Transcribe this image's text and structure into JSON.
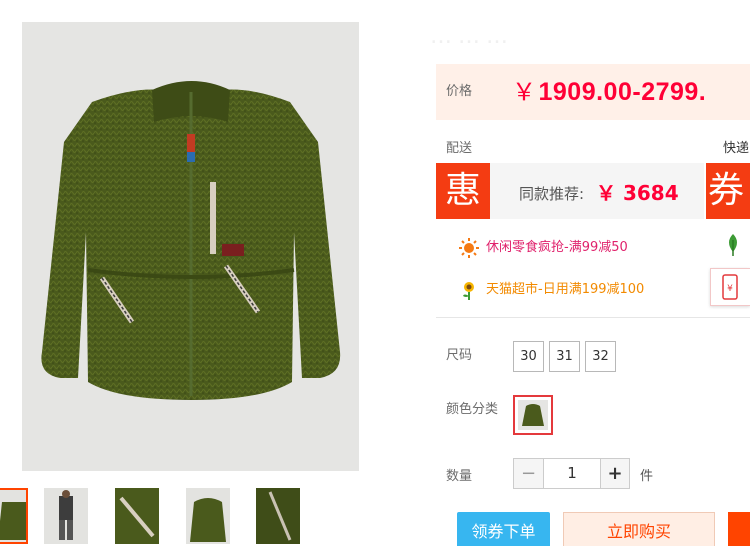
{
  "header": {
    "blur_text": "………"
  },
  "gallery": {
    "main_image_alt": "",
    "thumbnail_count": 5,
    "active_thumbnail": 1
  },
  "price": {
    "label": "价格",
    "currency": "￥",
    "value": "1909.00-2799."
  },
  "shipping": {
    "label": "配送",
    "value": "快递"
  },
  "promo": {
    "badge": "惠",
    "text": "同款推荐:",
    "currency": "￥",
    "price": "3684",
    "coupon_badge": "券"
  },
  "coupons": [
    {
      "text": "休闲零食疯抢-满99减50",
      "icon": "sun-icon"
    },
    {
      "text": "天猫超市-日用满199减100",
      "icon": "sunflower-icon"
    }
  ],
  "options": {
    "size_label": "尺码",
    "sizes": [
      "30",
      "31",
      "32"
    ],
    "color_label": "颜色分类",
    "quantity_label": "数量",
    "quantity": "1",
    "minus": "−",
    "plus": "+",
    "unit": "件"
  },
  "actions": {
    "coupon_button": "领券下单",
    "buy_button": "立即购买"
  },
  "colors": {
    "accent": "#ff0036",
    "badge": "#f43c12",
    "coupon_button": "#37b6f0",
    "jacket": "#4a5a1c"
  }
}
